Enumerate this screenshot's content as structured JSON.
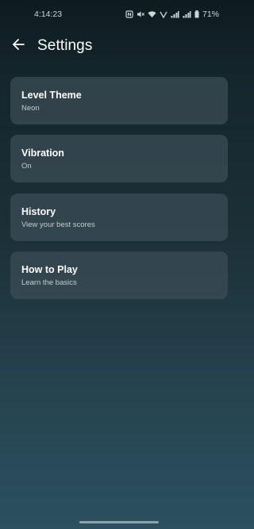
{
  "status_bar": {
    "time": "4:14:23",
    "battery": "71%"
  },
  "header": {
    "back_icon": "arrow-left-icon",
    "title": "Settings"
  },
  "settings": [
    {
      "title": "Level Theme",
      "subtitle": "Neon"
    },
    {
      "title": "Vibration",
      "subtitle": "On"
    },
    {
      "title": "History",
      "subtitle": "View your best scores"
    },
    {
      "title": "How to Play",
      "subtitle": "Learn the basics"
    }
  ],
  "colors": {
    "background_top": "#0e1b20",
    "background_bottom": "#2c5060",
    "card": "#3e5058",
    "text_primary": "#ffffff",
    "text_secondary": "#c3ccd0"
  }
}
